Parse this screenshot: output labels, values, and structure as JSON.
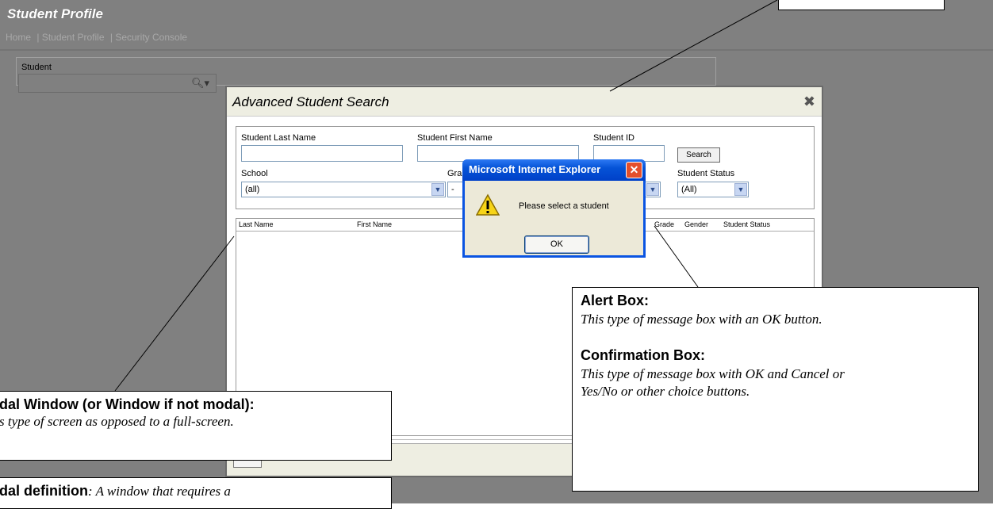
{
  "app": {
    "page_title": "Student Profile",
    "breadcrumb": [
      "Home",
      "| Student Profile",
      "| Security Console"
    ]
  },
  "student_panel": {
    "label": "Student",
    "search_icon": "search-dropdown-icon"
  },
  "modal": {
    "title": "Advanced Student Search",
    "close_icon": "collapse-icon",
    "fields": {
      "last_name_label": "Student Last Name",
      "first_name_label": "Student First Name",
      "student_id_label": "Student ID",
      "search_button": "Search",
      "school_label": "School",
      "school_value": "(all)",
      "grade_label": "Gra",
      "grade_value": "-",
      "status_label": "Student Status",
      "status_value": "(All)"
    },
    "results_columns": [
      "Last Name",
      "First Name",
      "Grade",
      "Gender",
      "Student Status"
    ]
  },
  "alert": {
    "title": "Microsoft Internet Explorer",
    "message": "Please select a student",
    "ok_button": "OK",
    "icon": "warning-icon"
  },
  "callouts": {
    "alert_box_heading": "Alert Box:",
    "alert_box_text": "This type of message box with an OK button.",
    "confirmation_heading": "Confirmation Box:",
    "confirmation_text": "This type of message box with OK and Cancel or Yes/No or other choice buttons.",
    "modal_heading": "dal Window (or Window if not modal):",
    "modal_text": "s type of screen as opposed to a full-screen.",
    "modal_def_heading": "dal definition",
    "modal_def_text": ": A window that requires a"
  }
}
